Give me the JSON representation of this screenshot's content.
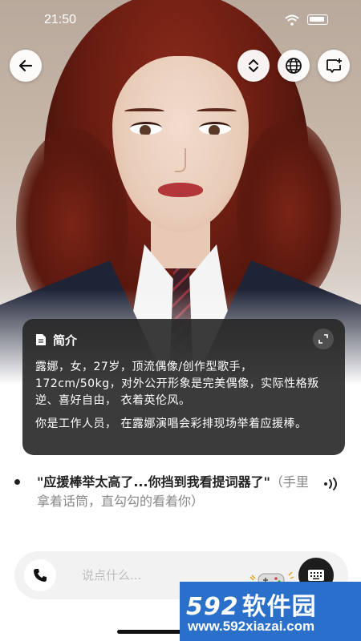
{
  "status_bar": {
    "time": "21:50"
  },
  "top_bar": {
    "back_icon": "arrow-left-icon",
    "expand_icon": "chevron-up-down-icon",
    "language_icon": "globe-icon",
    "new_chat_icon": "chat-plus-icon"
  },
  "intro_card": {
    "title": "简介",
    "icon": "document-icon",
    "collapse_icon": "collapse-arrows-icon",
    "paragraph1": "露娜，女，27岁，顶流偶像/创作型歌手，172cm/50kg，对外公开形象是完美偶像，实际性格叛逆、喜好自由， 衣着英伦风。",
    "paragraph2": "你是工作人员， 在露娜演唱会彩排现场举着应援棒。"
  },
  "message": {
    "speech": "\"应援棒举太高了...你挡到我看提词器了\"",
    "action": "（手里拿着话筒，直勾勾的看着你）",
    "speaker_icon": "speaker-wave-icon"
  },
  "input_bar": {
    "phone_icon": "phone-icon",
    "placeholder": "说点什么...",
    "gamepad_icon": "gamepad-icon",
    "keyboard_icon": "keyboard-icon"
  },
  "watermark": {
    "number": "592",
    "brand": "软件园",
    "url": "www.592xiazai.com"
  },
  "colors": {
    "intro_bg": "#262626",
    "watermark_bg": "#2a6fc9",
    "hair": "#6b1d12"
  }
}
